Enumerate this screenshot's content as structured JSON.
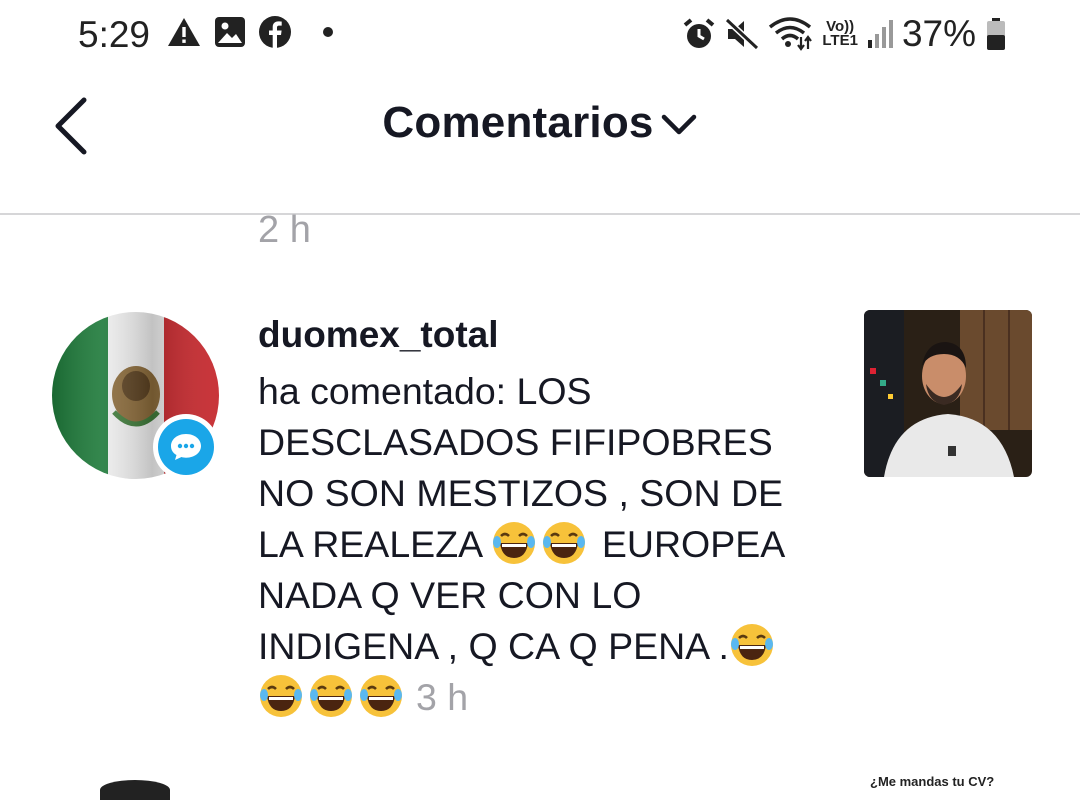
{
  "status_bar": {
    "time": "5:29",
    "battery_pct": "37%",
    "left_icons": [
      "alert-icon",
      "image-icon",
      "facebook-icon",
      "dot-icon"
    ],
    "right_icons": [
      "alarm-icon",
      "mute-icon",
      "wifi-icon",
      "volte-lte-icon",
      "signal-icon",
      "battery-icon"
    ],
    "volte_label": "Vo))",
    "lte_label": "LTE1"
  },
  "header": {
    "title": "Comentarios",
    "back_icon": "chevron-left-icon",
    "dropdown_icon": "chevron-down-icon"
  },
  "previous_item": {
    "timestamp": "2 h"
  },
  "comment": {
    "username": "duomex_total",
    "text_parts": [
      "ha comentado: LOS DESCLASADOS FIFIPOBRES NO SON MESTIZOS , SON DE LA REALEZA ",
      " EUROPEA NADA Q VER CON LO INDIGENA , Q CA Q PENA .",
      ""
    ],
    "timestamp": "3 h",
    "badge_icon": "comment-bubble-icon",
    "colors": {
      "badge": "#1aa6e8",
      "muted": "#a3a3a8"
    }
  },
  "next_item": {
    "thumb_text": "¿Me mandas tu CV?"
  }
}
